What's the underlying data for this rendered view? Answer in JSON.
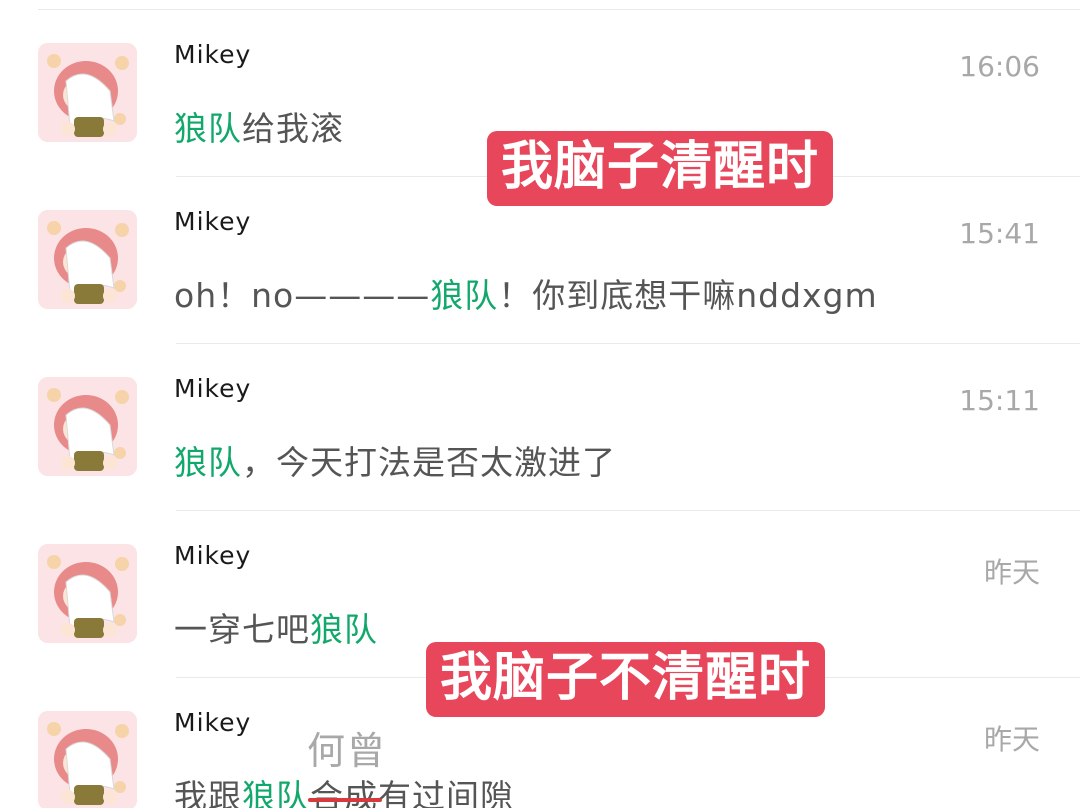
{
  "conversations": [
    {
      "name": "Mikey",
      "time": "16:06",
      "message": [
        {
          "text": "狼队",
          "highlight": true
        },
        {
          "text": "给我滚",
          "highlight": false
        }
      ]
    },
    {
      "name": "Mikey",
      "time": "15:41",
      "message": [
        {
          "text": "oh！no——",
          "highlight": false
        },
        {
          "text": "——",
          "highlight": false
        },
        {
          "text": "狼队",
          "highlight": true
        },
        {
          "text": "！你到底想干嘛nddxgm",
          "highlight": false
        }
      ]
    },
    {
      "name": "Mikey",
      "time": "15:11",
      "message": [
        {
          "text": "狼队",
          "highlight": true
        },
        {
          "text": "，今天打法是否太激进了",
          "highlight": false
        }
      ]
    },
    {
      "name": "Mikey",
      "time": "昨天",
      "message": [
        {
          "text": "一穿七吧",
          "highlight": false
        },
        {
          "text": "狼队",
          "highlight": true
        }
      ]
    },
    {
      "name": "Mikey",
      "time": "昨天",
      "message": [
        {
          "text": "我跟",
          "highlight": false
        },
        {
          "text": "狼队",
          "highlight": true
        },
        {
          "text": "合成",
          "highlight": false,
          "struck": true
        },
        {
          "text": "有过间隙",
          "highlight": false
        }
      ]
    }
  ],
  "captions": {
    "top": "我脑子清醒时",
    "bottom": "我脑子不清醒时"
  },
  "annotation": "何曾",
  "colors": {
    "highlight": "#12a86b",
    "caption_bg": "#e8465a",
    "strike": "#d63a3c",
    "time": "#a8a8a8"
  },
  "icons": {
    "avatar": "anime-girl-avatar"
  }
}
